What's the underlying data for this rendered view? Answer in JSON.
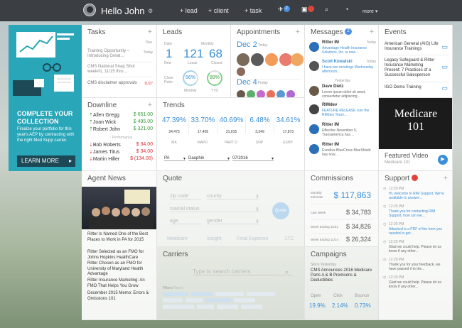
{
  "topbar": {
    "greeting": "Hello John",
    "links": [
      "+ lead",
      "+ client",
      "+ task"
    ],
    "badge1": "2",
    "badge2": "2",
    "more": "more"
  },
  "promo": {
    "title": "COMPLETE YOUR COLLECTION",
    "body": "Finalize your portfolio for this year's AEP by contracting with the right Med Supp carrier.",
    "cta": "LEARN MORE"
  },
  "tasks": {
    "title": "Tasks",
    "due": "Due",
    "items": [
      {
        "text": "Training Opportunity – Introducing Great…",
        "date": "Today"
      },
      {
        "text": "CMS National Snap Shot week#1, 11/15 thru…",
        "date": ""
      },
      {
        "text": "CMS disclaimer approvals",
        "date": "11/27"
      }
    ]
  },
  "downline": {
    "title": "Downline",
    "sub": "Performance",
    "items": [
      {
        "name": "Allen Gregg",
        "amt": "$ 651.00"
      },
      {
        "name": "Joan Wick",
        "amt": "$ 495.00"
      },
      {
        "name": "Robert John",
        "amt": "$ 321.00"
      },
      {
        "name": "Bob Roberts",
        "amt": "$ 34.00"
      },
      {
        "name": "James Titus",
        "amt": "$ 34.00"
      },
      {
        "name": "Martin Hiller",
        "amt": "$ (134.00)"
      }
    ]
  },
  "leads": {
    "title": "Leads",
    "daily": "Daily",
    "monthly": "Monthly",
    "new_val": "1",
    "new_lbl": "New",
    "leads_val": "121",
    "leads_lbl": "Leads",
    "closed_val": "68",
    "closed_lbl": "Closed",
    "close_ratio": "Close Ratio",
    "monthly_pct": "56%",
    "ytd_pct": "89%",
    "monthly_l": "Monthly",
    "ytd_l": "YTD"
  },
  "appointments": {
    "title": "Appointments",
    "d1": "Dec 2",
    "d1s": "Today",
    "d2": "Dec 4",
    "d2s": "Friday"
  },
  "messages": {
    "title": "Messages",
    "badge": "2",
    "yesterday": "Yesterday",
    "items": [
      {
        "from": "Ritter IM",
        "text": "Advantage Health Insurance Solutions, Inc. is now…",
        "time": "Today"
      },
      {
        "from": "Scott Kowalski",
        "text": "I have two meetings Wednesday afternoon…",
        "time": "Today"
      },
      {
        "from": "Dave Dietz",
        "text": "Lorem ipsum dolor sit amet, consectetur adipiscing…",
        "time": ""
      },
      {
        "from": "RIMdev",
        "text": "FEATURE RELEASE Join the RIMdev Team…",
        "time": ""
      },
      {
        "from": "Ritter IM",
        "text": "Effective November 9, Transamerica has…",
        "time": ""
      },
      {
        "from": "Ritter IM",
        "text": "Excellus BlueCross BlueShield has now…",
        "time": ""
      }
    ]
  },
  "events": {
    "title": "Events",
    "items": [
      "American General (AIG) Life Insurance Trainings",
      "Legacy Safeguard & Ritter Insurance Marketing Present: 7 Practices of a Successful Salesperson",
      "IGO Demo Training"
    ]
  },
  "video": {
    "banner": "Medicare 101",
    "title": "Featured Video",
    "sub": "Medicare 101"
  },
  "trends": {
    "title": "Trends",
    "cols": [
      {
        "pct": "47.39%",
        "val": "24,473",
        "lbl": "MA"
      },
      {
        "pct": "33.70%",
        "val": "17,405",
        "lbl": "MAPD"
      },
      {
        "pct": "40.69%",
        "val": "21,015",
        "lbl": "PART D"
      },
      {
        "pct": "6.48%",
        "val": "3,349",
        "lbl": "SNP"
      },
      {
        "pct": "34.61%",
        "val": "17,873",
        "lbl": "ESHP"
      }
    ],
    "state": "PA",
    "county": "Dauphin",
    "date": "07/2016"
  },
  "agent_news": {
    "title": "Agent News",
    "items": [
      "Ritter Is Named One of the Best Places to Work in PA for 2015",
      "Ritter Selected as an FMO for Johns Hopkins HealthCare",
      "Ritter Chosen as an FMO for University of Maryland Health Advantage",
      "Ritter Insurance Marketing: An FMO That Helps You Grow",
      "December 2015 Memo: Errors & Omissions 101"
    ]
  },
  "quote": {
    "title": "Quote",
    "zip": "zip code",
    "county": "county",
    "marital": "marital status",
    "age": "age",
    "gender": "gender",
    "button": "Quote",
    "tabs": [
      "Medicare",
      "Insight",
      "Final Expense",
      "LTC"
    ]
  },
  "carriers": {
    "title": "Carriers",
    "search": "Type to search carriers",
    "filters": "Filters",
    "reset": "Reset"
  },
  "commissions": {
    "title": "Commissions",
    "rows": [
      {
        "label": "Monthly Estimate",
        "amt": "$ 117,863"
      },
      {
        "label": "Last Week",
        "amt": "$ 34,783"
      },
      {
        "label": "Week Ending 11/21",
        "amt": "$ 34,826"
      },
      {
        "label": "Week Ending 11/14",
        "amt": "$ 26,324"
      }
    ]
  },
  "campaigns": {
    "title": "Campaigns",
    "since": "Since Yesterday",
    "item": "CMS Announces 2016 Medicare Parts A & B Premiums & Deductibles",
    "open_l": "Open",
    "click_l": "Click",
    "bounce_l": "Bounce",
    "open": "19.9%",
    "click": "2.14%",
    "bounce": "0.73%"
  },
  "support": {
    "title": "Support",
    "badge": "3",
    "items": [
      {
        "time": "12:20 PM",
        "text": "Hi, welcome to RIM Support, We're available to answer..."
      },
      {
        "time": "12:20 PM",
        "text": "Thank you for contacting RIM Support, how can we..."
      },
      {
        "time": "12:20 PM",
        "text": "Attached is a PDF of the form you needed to get..."
      },
      {
        "time": "12:20 PM",
        "text": "Glad we could help. Please let us know if any other..."
      },
      {
        "time": "12:20 PM",
        "text": "Thank you for your feedback, we have passed it to the..."
      },
      {
        "time": "12:20 PM",
        "text": "Glad we could help. Please let us know if any other..."
      }
    ]
  }
}
